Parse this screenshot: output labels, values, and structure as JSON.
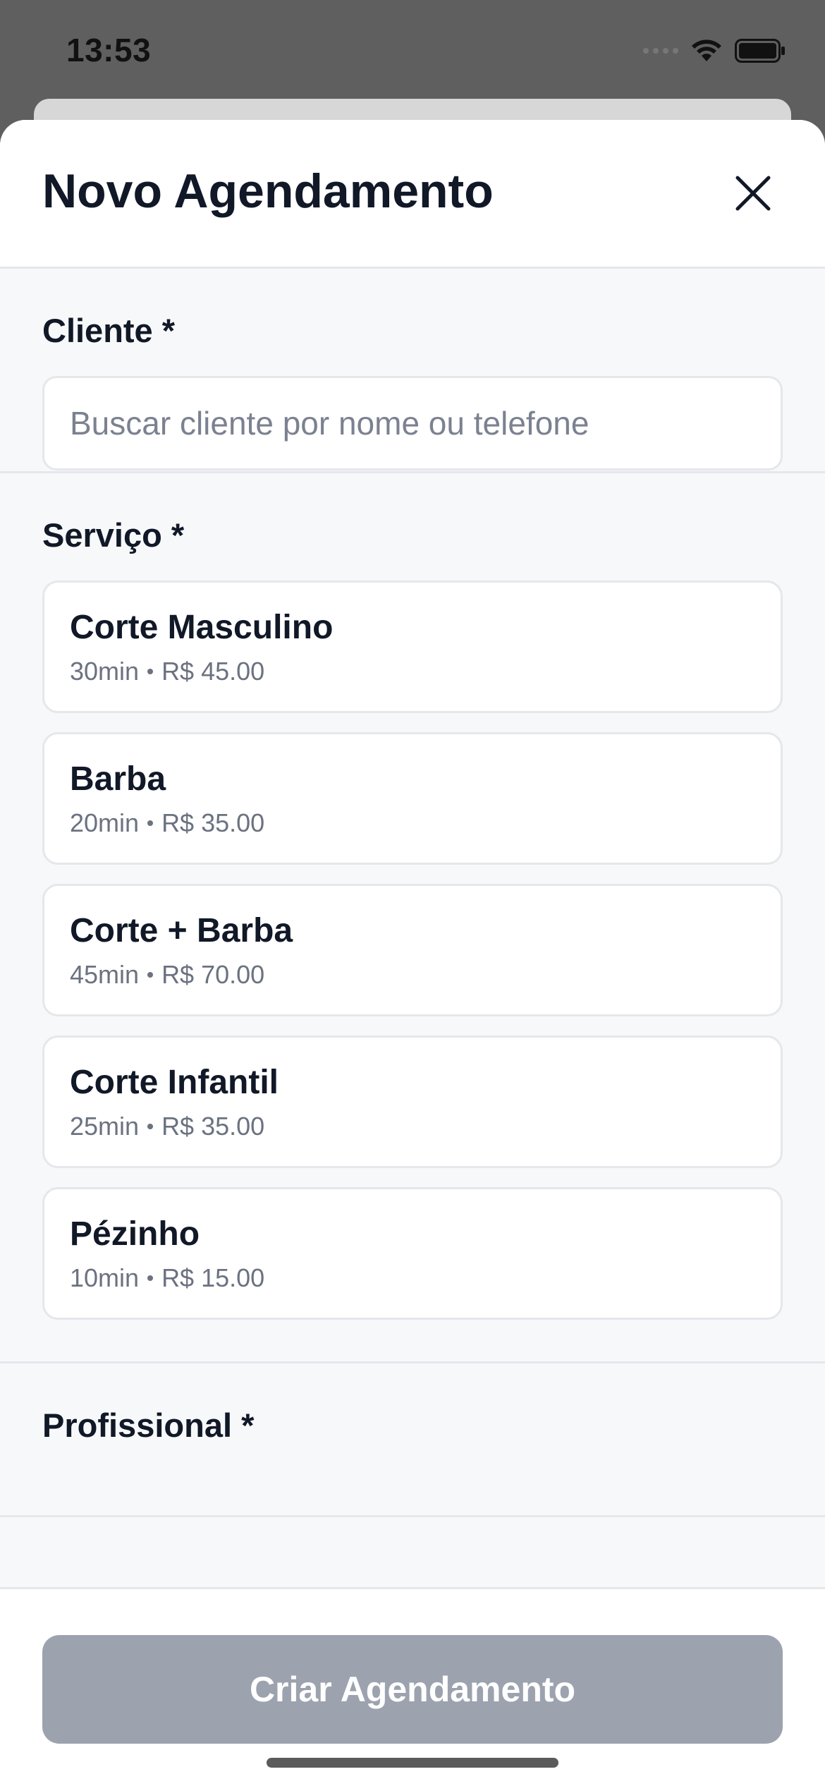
{
  "status_bar": {
    "time": "13:53"
  },
  "sheet": {
    "title": "Novo Agendamento",
    "close_icon": "close-icon"
  },
  "client": {
    "label": "Cliente *",
    "placeholder": "Buscar cliente por nome ou telefone",
    "value": ""
  },
  "service": {
    "label": "Serviço *",
    "items": [
      {
        "name": "Corte Masculino",
        "duration": "30min",
        "price": "R$ 45.00"
      },
      {
        "name": "Barba",
        "duration": "20min",
        "price": "R$ 35.00"
      },
      {
        "name": "Corte + Barba",
        "duration": "45min",
        "price": "R$ 70.00"
      },
      {
        "name": "Corte Infantil",
        "duration": "25min",
        "price": "R$ 35.00"
      },
      {
        "name": "Pézinho",
        "duration": "10min",
        "price": "R$ 15.00"
      }
    ]
  },
  "professional": {
    "label": "Profissional *"
  },
  "footer": {
    "create_label": "Criar Agendamento",
    "disabled_color": "#9ca3af"
  },
  "colors": {
    "text_primary": "#111827",
    "text_secondary": "#6b7280",
    "border": "#e5e7eb",
    "backdrop": "#5f5f5f"
  }
}
